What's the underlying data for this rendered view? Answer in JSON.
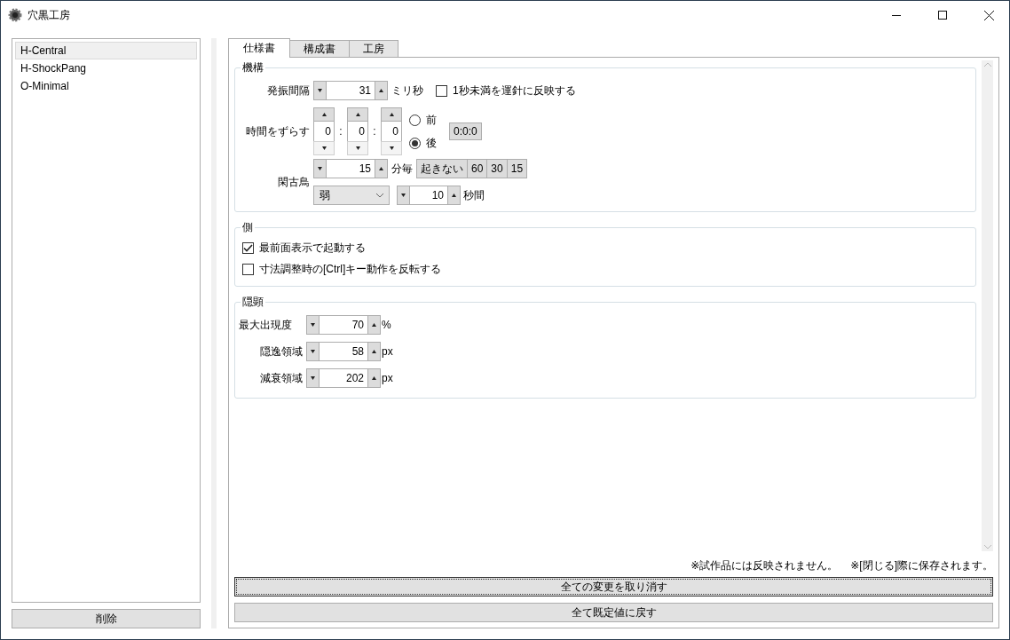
{
  "window": {
    "title": "穴黒工房"
  },
  "sidebar": {
    "items": [
      {
        "label": "H-Central",
        "selected": true
      },
      {
        "label": "H-ShockPang",
        "selected": false
      },
      {
        "label": "O-Minimal",
        "selected": false
      }
    ],
    "delete_button": "削除"
  },
  "tabs": [
    {
      "label": "仕様書",
      "selected": true
    },
    {
      "label": "構成書",
      "selected": false
    },
    {
      "label": "工房",
      "selected": false
    }
  ],
  "mechanism": {
    "title": "機構",
    "interval": {
      "label": "発振間隔",
      "value": "31",
      "unit": "ミリ秒",
      "checkbox": {
        "label": "1秒未満を運針に反映する",
        "checked": false
      }
    },
    "shift": {
      "label": "時間をずらす",
      "fields": [
        "0",
        "0",
        "0"
      ],
      "separators": [
        ":",
        ":"
      ],
      "radios": [
        {
          "label": "前",
          "selected": false
        },
        {
          "label": "後",
          "selected": true
        }
      ],
      "button": "0:0:0"
    },
    "cuckoo": {
      "label": "閑古鳥",
      "value": "15",
      "unit": "分毎",
      "presets": [
        "起きない",
        "60",
        "30",
        "15"
      ],
      "dropdown": "弱",
      "duration": "10",
      "duration_unit": "秒間"
    }
  },
  "side": {
    "title": "側",
    "checkboxes": [
      {
        "label": "最前面表示で起動する",
        "checked": true
      },
      {
        "label": "寸法調整時の[Ctrl]キー動作を反転する",
        "checked": false
      }
    ]
  },
  "visibility": {
    "title": "隠顕",
    "rows": [
      {
        "label": "最大出現度",
        "value": "70",
        "unit": "%"
      },
      {
        "label": "隠逸領域",
        "value": "58",
        "unit": "px"
      },
      {
        "label": "減衰領域",
        "value": "202",
        "unit": "px"
      }
    ]
  },
  "notes": [
    "※試作品には反映されません。",
    "※[閉じる]際に保存されます。"
  ],
  "buttons": {
    "cancel": "全ての変更を取り消す",
    "reset": "全て既定値に戻す"
  }
}
